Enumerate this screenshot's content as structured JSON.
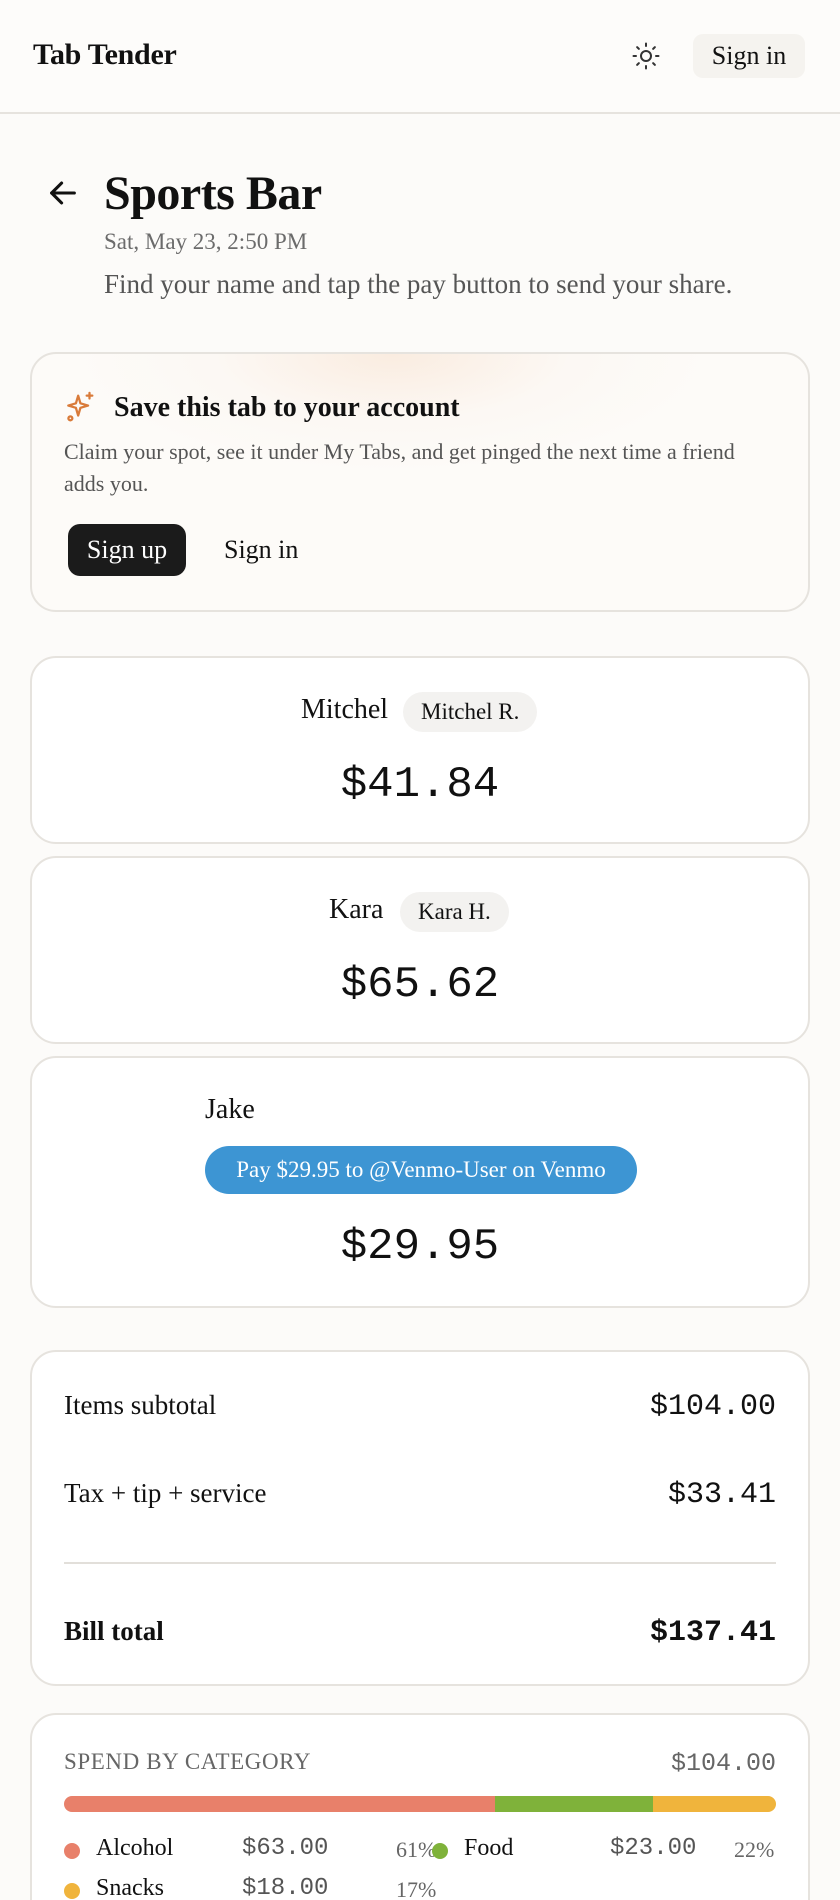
{
  "header": {
    "brand": "Tab Tender",
    "theme_icon": "sun-icon",
    "signin_label": "Sign in"
  },
  "page": {
    "back_icon": "arrow-left-icon",
    "title": "Sports Bar",
    "date": "Sat, May 23, 2:50 PM",
    "subtitle": "Find your name and tap the pay button to send your share."
  },
  "promo": {
    "icon": "sparkles-icon",
    "title": "Save this tab to your account",
    "body": "Claim your spot, see it under My Tabs, and get pinged the next time a friend adds you.",
    "signup_label": "Sign up",
    "signin_label": "Sign in"
  },
  "people": [
    {
      "name": "Mitchel",
      "chip": "Mitchel R.",
      "amount": "$41.84"
    },
    {
      "name": "Kara",
      "chip": "Kara H.",
      "amount": "$65.62"
    },
    {
      "name": "Jake",
      "pay_label": "Pay $29.95 to @Venmo-User on Venmo",
      "amount": "$29.95"
    }
  ],
  "totals": {
    "subtotal_label": "Items subtotal",
    "subtotal_value": "$104.00",
    "extras_label": "Tax + tip + service",
    "extras_value": "$33.41",
    "total_label": "Bill total",
    "total_value": "$137.41"
  },
  "spend": {
    "title": "SPEND BY CATEGORY",
    "total": "$104.00",
    "categories": [
      {
        "label": "Alcohol",
        "amount": "$63.00",
        "pct": "61%",
        "share": 0.6058,
        "color": "#e8806a"
      },
      {
        "label": "Food",
        "amount": "$23.00",
        "pct": "22%",
        "share": 0.2212,
        "color": "#7fb23a"
      },
      {
        "label": "Snacks",
        "amount": "$18.00",
        "pct": "17%",
        "share": 0.1731,
        "color": "#f0b43c"
      }
    ]
  },
  "colors": {
    "venmo_blue": "#3d95d3",
    "accent_orange": "#d97b3a"
  }
}
